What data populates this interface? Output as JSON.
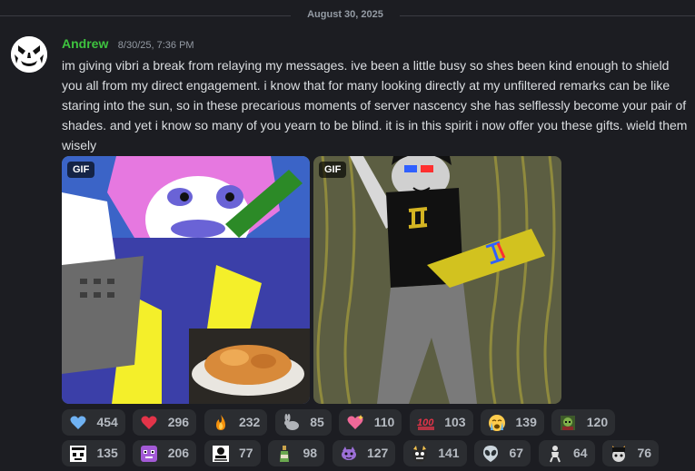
{
  "date_divider": "August 30, 2025",
  "message": {
    "author": "Andrew",
    "timestamp": "8/30/25, 7:36 PM",
    "author_color": "#3ec33f",
    "text": "im giving vibri a break from relaying my messages. ive been a little busy so shes been kind enough to shield you all from my direct engagement. i know that for many looking directly at my unfiltered remarks can be like staring into the sun, so in these precarious moments of server nascency she has selflessly become your pair of shades. and yet i know so many of you yearn to be blind. it is in this spirit i now offer you these gifts. wield them wisely",
    "attachments": [
      {
        "badge": "GIF",
        "description_icon": "gif-pink-hair-character"
      },
      {
        "badge": "GIF",
        "description_icon": "gif-laptop-character"
      }
    ]
  },
  "reactions": [
    [
      {
        "icon": "blue-heart-icon",
        "count": "454"
      },
      {
        "icon": "red-heart-icon",
        "count": "296"
      },
      {
        "icon": "fire-icon",
        "count": "232"
      },
      {
        "icon": "rabbit-icon",
        "count": "85"
      },
      {
        "icon": "sparkling-heart-icon",
        "count": "110"
      },
      {
        "icon": "hundred-points-icon",
        "count": "103"
      },
      {
        "icon": "crying-face-icon",
        "count": "139"
      },
      {
        "icon": "custom-goblin-icon",
        "count": "120"
      }
    ],
    [
      {
        "icon": "custom-i-care-icon",
        "count": "135"
      },
      {
        "icon": "custom-purple-face-icon",
        "count": "206"
      },
      {
        "icon": "custom-maybe-icon",
        "count": "77"
      },
      {
        "icon": "custom-bottle-icon",
        "count": "98"
      },
      {
        "icon": "custom-purple-creature-icon",
        "count": "127"
      },
      {
        "icon": "custom-dark-face-icon",
        "count": "141"
      },
      {
        "icon": "alien-icon",
        "count": "67"
      },
      {
        "icon": "custom-figure-icon",
        "count": "64"
      },
      {
        "icon": "custom-horned-icon",
        "count": "76"
      }
    ]
  ]
}
